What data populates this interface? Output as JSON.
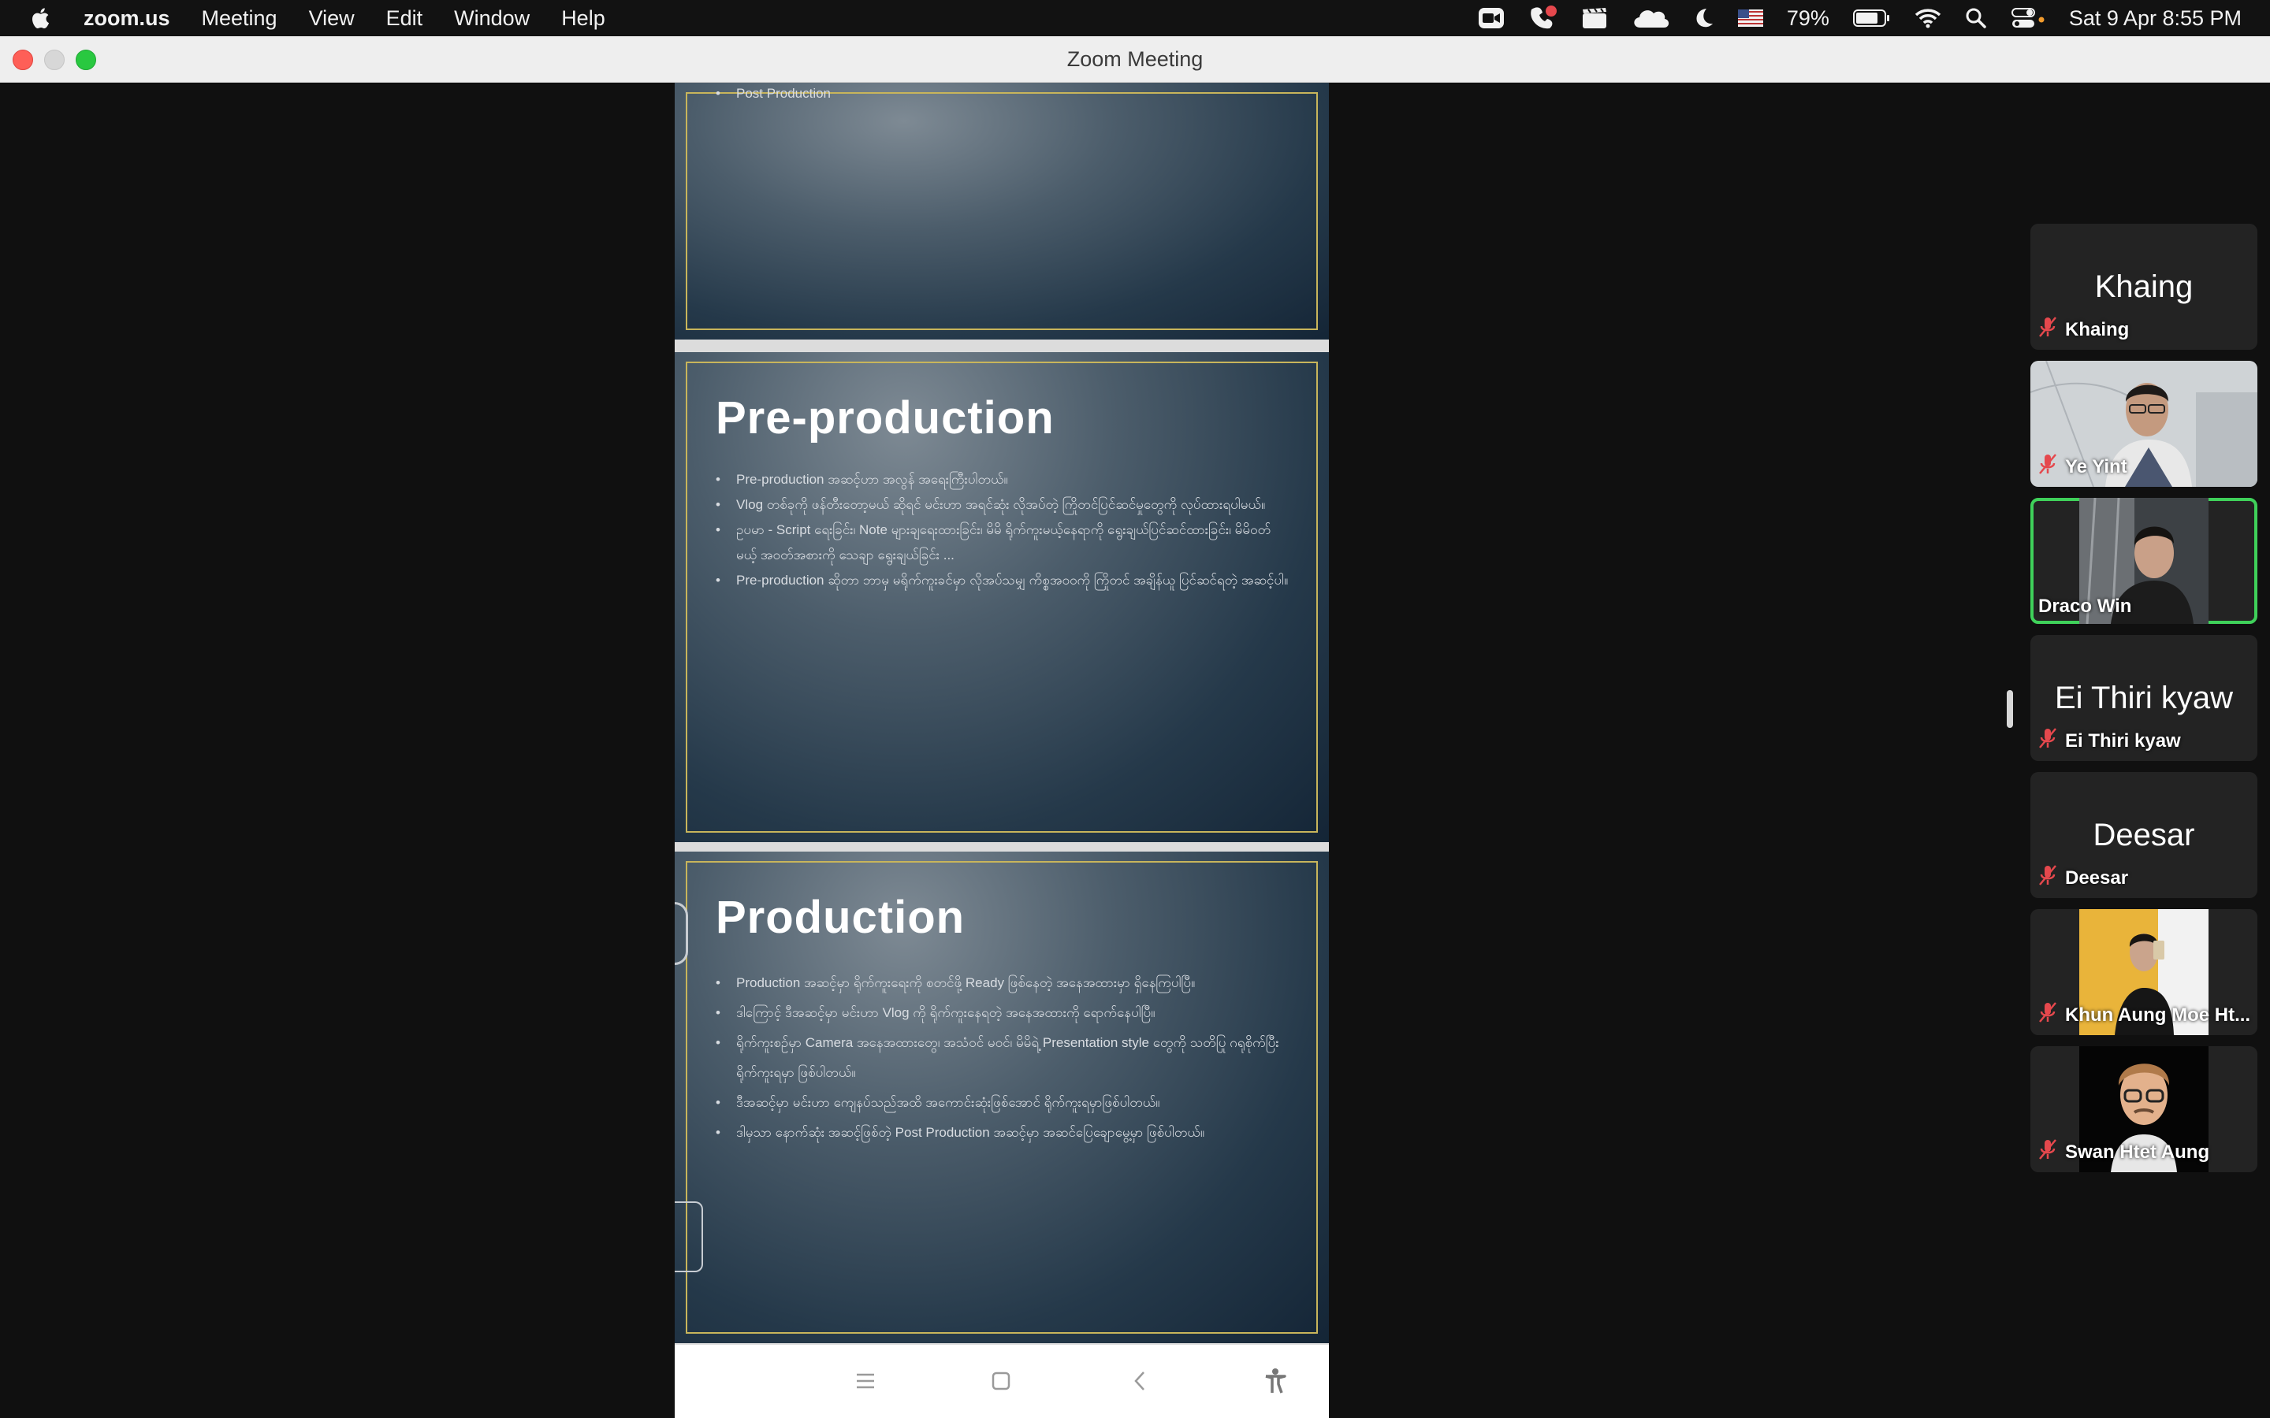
{
  "menubar": {
    "app_name": "zoom.us",
    "menus": [
      "Meeting",
      "View",
      "Edit",
      "Window",
      "Help"
    ],
    "battery": "79%",
    "datetime": "Sat 9 Apr  8:55 PM"
  },
  "window": {
    "title": "Zoom Meeting"
  },
  "slides": [
    {
      "bullets": [
        "Post Production"
      ]
    },
    {
      "title": "Pre-production",
      "bullets": [
        "Pre-production အဆင့်ဟာ အလွန် အရေးကြီးပါတယ်။",
        "Vlog တစ်ခုကို ဖန်တီးတော့မယ် ဆိုရင် မင်းဟာ အရင်ဆုံး လိုအပ်တဲ့ ကြိုတင်ပြင်ဆင်မှုတွေကို လုပ်ထားရပါမယ်။",
        "ဥပမာ - Script ရေးခြင်း၊ Note များချရေးထားခြင်း၊ မိမိ ရိုက်ကူးမယ့်နေရာကို ရွေးချယ်ပြင်ဆင်ထားခြင်း၊ မိမိဝတ်မယ့် အဝတ်အစားကို သေချာ ရွေးချယ်ခြင်း ...",
        "Pre-production ဆိုတာ ဘာမှ မရိုက်ကူးခင်မှာ လိုအပ်သမျှ ကိစ္စအဝဝကို ကြိုတင် အချိန်ယူ ပြင်ဆင်ရတဲ့ အဆင့်ပါ။"
      ]
    },
    {
      "title": "Production",
      "bullets": [
        "Production အဆင့်မှာ ရိုက်ကူးရေးကို စတင်ဖို့ Ready ဖြစ်နေတဲ့ အနေအထားမှာ ရှိနေကြပါပြီ။",
        "ဒါကြောင့် ဒီအဆင့်မှာ မင်းဟာ Vlog ကို ရိုက်ကူးနေရတဲ့ အနေအထားကို ရောက်နေပါပြီ။",
        "ရိုက်ကူးစဥ်မှာ Camera အနေအထားတွေ၊ အသံဝင် မဝင်၊ မိမိရဲ့ Presentation style တွေကို သတိပြု ဂရုစိုက်ပြီး ရိုက်ကူးရမှာ ဖြစ်ပါတယ်။",
        "ဒီအဆင့်မှာ မင်းဟာ ကျေနပ်သည်အထိ အကောင်းဆုံးဖြစ်အောင် ရိုက်ကူးရမှာဖြစ်ပါတယ်။",
        "ဒါမှသာ နောက်ဆုံး အဆင့်ဖြစ်တဲ့ Post Production အဆင့်မှာ အဆင်ပြေချောမွေ့မှာ ဖြစ်ပါတယ်။"
      ]
    }
  ],
  "participants": [
    {
      "name": "Khaing",
      "big_name": "Khaing",
      "muted": true,
      "video": false
    },
    {
      "name": "Ye Yint",
      "muted": true,
      "video": true
    },
    {
      "name": "Draco Win",
      "muted": false,
      "video": true,
      "active": true
    },
    {
      "name": "Ei Thiri kyaw",
      "big_name": "Ei Thiri kyaw",
      "muted": true,
      "video": false
    },
    {
      "name": "Deesar",
      "big_name": "Deesar",
      "muted": true,
      "video": false
    },
    {
      "name": "Khun Aung Moe Ht...",
      "muted": true,
      "video": true
    },
    {
      "name": "Swan Htet Aung",
      "muted": true,
      "video": true
    }
  ],
  "colors": {
    "active_speaker": "#3fd15a",
    "muted_icon": "#e5484d",
    "slide_border": "#c8b55b"
  }
}
